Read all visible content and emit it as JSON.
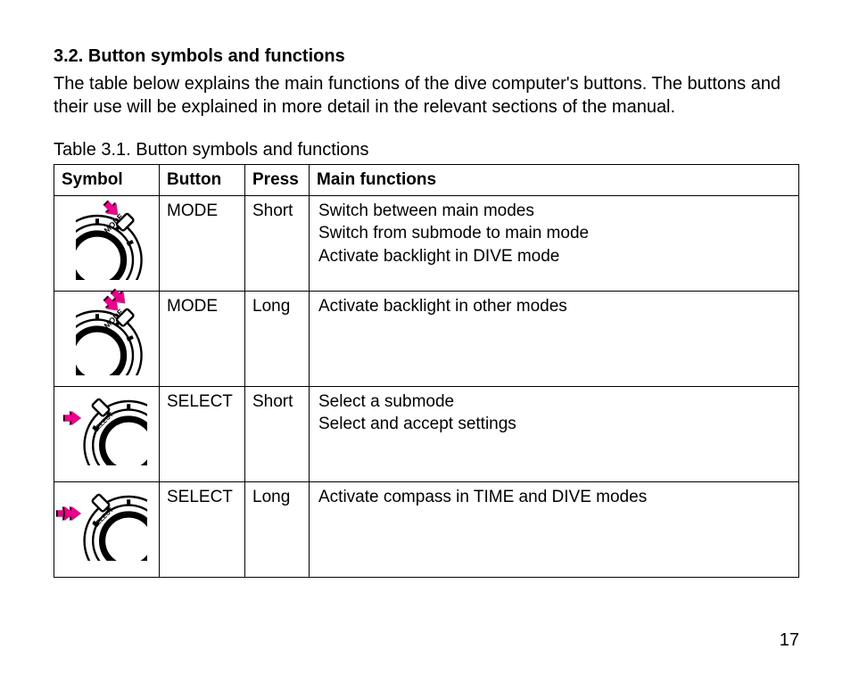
{
  "section": {
    "heading": "3.2. Button symbols and functions",
    "intro": "The table below explains the main functions of the dive computer's buttons. The buttons and their use will be explained in more detail in the relevant sections of the manual."
  },
  "table": {
    "caption": "Table 3.1.  Button symbols and functions",
    "headers": {
      "symbol": "Symbol",
      "button": "Button",
      "press": "Press",
      "functions": "Main functions"
    },
    "rows": [
      {
        "symbol": {
          "button_label": "MODE",
          "arrow_count": 1
        },
        "button": "MODE",
        "press": "Short",
        "functions": [
          "Switch between main modes",
          "Switch from submode to main mode",
          "Activate backlight in DIVE mode"
        ]
      },
      {
        "symbol": {
          "button_label": "MODE",
          "arrow_count": 2
        },
        "button": "MODE",
        "press": "Long",
        "functions": [
          "Activate backlight in other modes"
        ]
      },
      {
        "symbol": {
          "button_label": "SELECT",
          "arrow_count": 1
        },
        "button": "SELECT",
        "press": "Short",
        "functions": [
          "Select a submode",
          "Select and accept settings"
        ]
      },
      {
        "symbol": {
          "button_label": "SELECT",
          "arrow_count": 2
        },
        "button": "SELECT",
        "press": "Long",
        "functions": [
          "Activate compass in TIME and DIVE modes"
        ]
      }
    ]
  },
  "page_number": "17"
}
